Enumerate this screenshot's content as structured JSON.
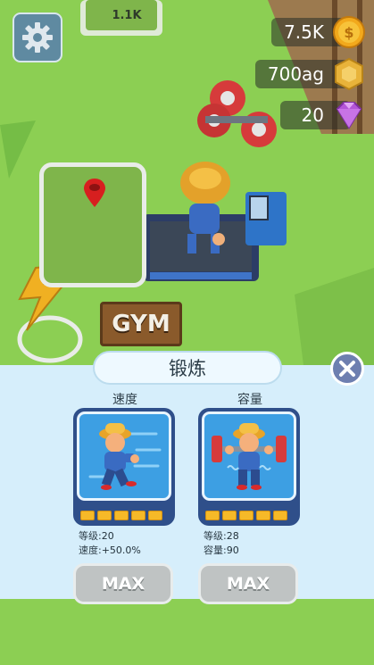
{
  "hud": {
    "coins": "7.5K",
    "weight": "700ag",
    "gems": "20",
    "sign_value": "1.1K"
  },
  "scene": {
    "gym_sign": "GYM"
  },
  "panel": {
    "title": "锻炼",
    "cards": [
      {
        "label": "速度",
        "level_label": "等级:",
        "level_value": "20",
        "stat_label": "速度:",
        "stat_value": "+50.0%",
        "level_fill": 5,
        "button": "MAX"
      },
      {
        "label": "容量",
        "level_label": "等级:",
        "level_value": "28",
        "stat_label": "容量:",
        "stat_value": "90",
        "level_fill": 5,
        "button": "MAX"
      }
    ]
  },
  "colors": {
    "coin": "#f2a91c",
    "gem": "#b455d8",
    "panel_bg": "#d6eefb",
    "card_bg": "#3d9fe3"
  },
  "icons": [
    "gear-icon",
    "dollar-coin-icon",
    "hexagon-nut-icon",
    "gem-icon",
    "close-icon",
    "map-pin-icon",
    "lightning-icon"
  ]
}
